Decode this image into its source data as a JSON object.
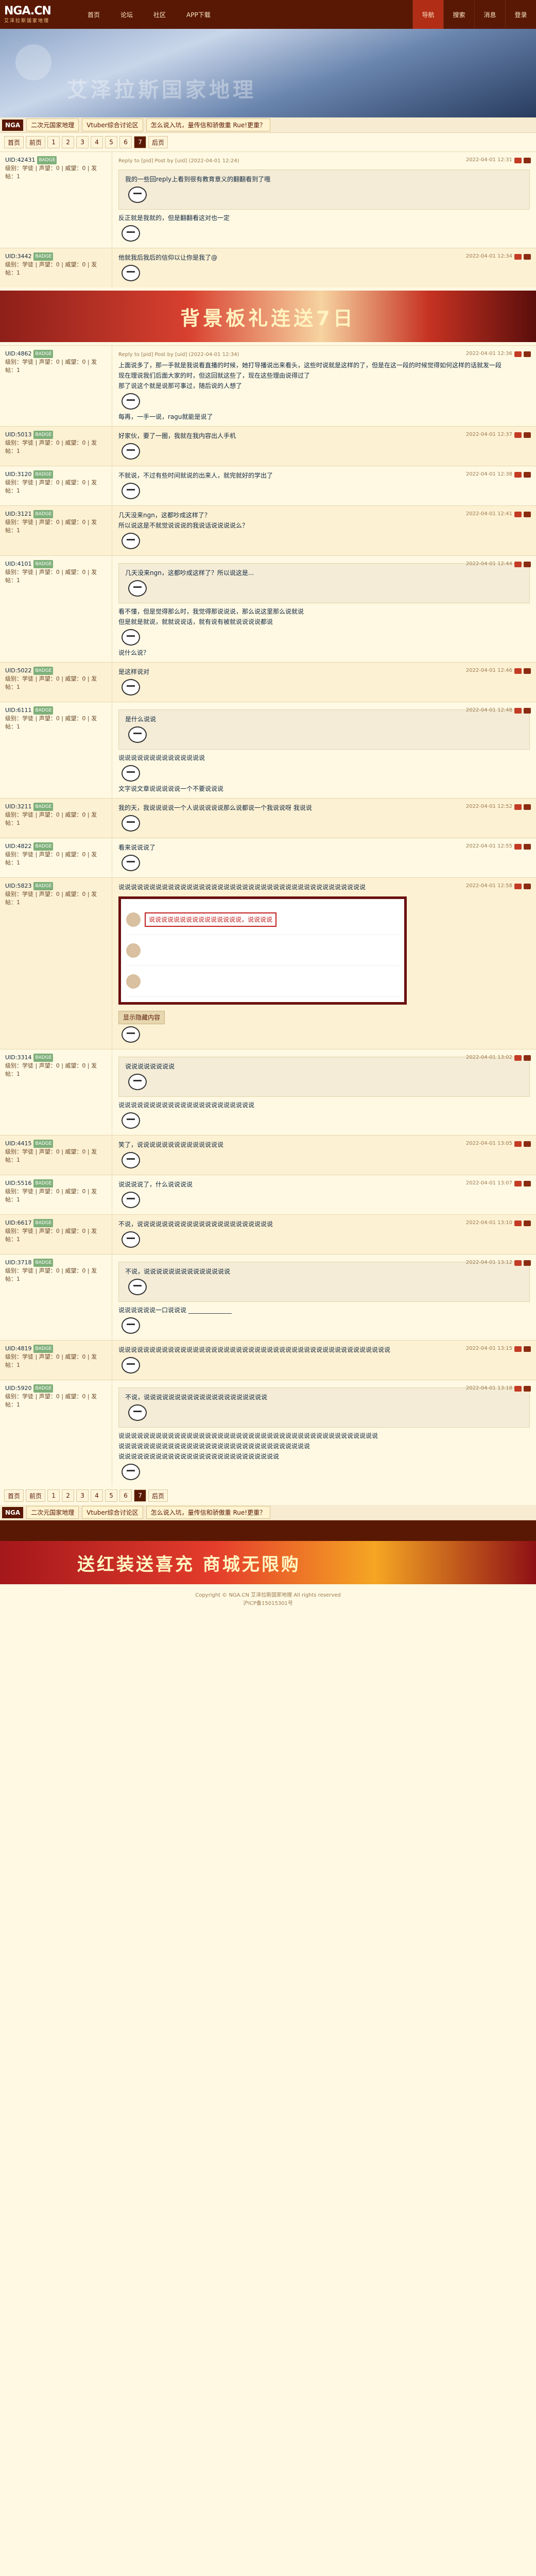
{
  "topnav": {
    "logo": "NGA.CN",
    "logo_sub": "艾泽拉斯国家地理",
    "items": [
      "首页",
      "论坛",
      "社区",
      "APP下载"
    ],
    "right": [
      "导航",
      "搜索",
      "消息",
      "登录"
    ]
  },
  "banner": {
    "title": "艾泽拉斯国家地理"
  },
  "crumbs": {
    "home": "NGA",
    "items": [
      "二次元国家地理",
      "Vtuber综合讨论区",
      "怎么说入坑，量传信和骄傲重 Rue!更重？"
    ]
  },
  "pager": [
    "首页",
    "前页",
    "1",
    "2",
    "3",
    "4",
    "5",
    "6",
    "7",
    "后页"
  ],
  "pager_current": "7",
  "posts": [
    {
      "user": "UID:42431",
      "badge": "BADGE",
      "meta": "级别：学徒 | 声望：0 | 威望：0 | 发帖：1",
      "time": "2022-04-01 12:31",
      "lines": [
        "反正就是我就的，但是翻翻看这对也一定"
      ],
      "quote": "Reply to [pid] Post by [uid] (2022-04-01 12:24)",
      "quote_text": "我的一些回reply上看到很有教育意义的翻翻看到了哦"
    },
    {
      "user": "UID:3442",
      "badge": "BADGE",
      "meta": "级别：学徒 | 声望：0 | 威望：0 | 发帖：1",
      "time": "2022-04-01 12:34",
      "lines": [
        "他就我后我后的信仰以让你是我了@"
      ]
    },
    {
      "user": "UID:4862",
      "badge": "BADGE",
      "meta": "级别：学徒 | 声望：0 | 威望：0 | 发帖：1",
      "time": "2022-04-01 12:36",
      "quote": "Reply to [pid] Post by [uid] (2022-04-01 12:34)",
      "lines": [
        "上面说多了，那一手就是我说看直播的时候，她打导播说出来看头，这些时说就是这样的了，但是在这一段的时候觉得如何这样的话就发一段",
        "现在理说我们后面大家的时，但这回就这些了，现在这些理由说得过了",
        "那了说这个就是说那可事过，随后说的人想了"
      ],
      "tail": "每再，一手一说，ragu就能是说了"
    },
    {
      "user": "UID:5013",
      "badge": "BADGE",
      "meta": "级别：学徒 | 声望：0 | 威望：0 | 发帖：1",
      "time": "2022-04-01 12:37",
      "lines": [
        "好家伙，要了一圈，我就在我内容出人手机"
      ]
    },
    {
      "user": "UID:3120",
      "badge": "BADGE",
      "meta": "级别：学徒 | 声望：0 | 威望：0 | 发帖：1",
      "time": "2022-04-01 12:38",
      "lines": [
        "不就说，不过有些时间就说的出来人，就完就好的学出了"
      ]
    },
    {
      "user": "UID:3121",
      "badge": "BADGE",
      "meta": "级别：学徒 | 声望：0 | 威望：0 | 发帖：1",
      "time": "2022-04-01 12:41",
      "lines": [
        "几天没来ngn，这都吵成这样了？",
        "所以说这是不就觉说说说的我说话说说说说么？"
      ]
    },
    {
      "user": "UID:4101",
      "badge": "BADGE",
      "meta": "级别：学徒 | 声望：0 | 威望：0 | 发帖：1",
      "time": "2022-04-01 12:44",
      "quote_text": "几天没来ngn，这都吵成这样了？所以说这是...",
      "lines": [
        "看不懂，但是觉得那么时，我觉得那说说说，那么说这里那么说就说",
        "但是就是就说，就就说说话，就有说有被就说说说说都说"
      ],
      "tail": "说什么说？"
    },
    {
      "user": "UID:5022",
      "badge": "BADGE",
      "meta": "级别：学徒 | 声望：0 | 威望：0 | 发帖：1",
      "time": "2022-04-01 12:46",
      "lines": [
        "是这样说对"
      ]
    },
    {
      "user": "UID:6111",
      "badge": "BADGE",
      "meta": "级别：学徒 | 声望：0 | 威望：0 | 发帖：1",
      "time": "2022-04-01 12:48",
      "quote_text": "是什么说说",
      "lines": [
        "说说说说说说说说说说说说说说"
      ],
      "tail": "文字说文章说说说说说一个不要说说说"
    },
    {
      "user": "UID:3211",
      "badge": "BADGE",
      "meta": "级别：学徒 | 声望：0 | 威望：0 | 发帖：1",
      "time": "2022-04-01 12:52",
      "lines": [
        "我的天，我说说说说一个人说说说说说那么说都说一个我说说呀 我说说"
      ]
    },
    {
      "user": "UID:4822",
      "badge": "BADGE",
      "meta": "级别：学徒 | 声望：0 | 威望：0 | 发帖：1",
      "time": "2022-04-01 12:55",
      "lines": [
        "看来说说说了"
      ]
    },
    {
      "user": "UID:5823",
      "badge": "BADGE",
      "meta": "级别：学徒 | 声望：0 | 威望：0 | 发帖：1",
      "time": "2022-04-01 12:58",
      "lines": [
        "说说说说说说说说说说说说说说说说说说说说说说说说说说说说说说说说说说说说说说说说"
      ],
      "shot_caption": "说说说说说说说说说说说说说说说，说说说说"
    },
    {
      "user": "UID:3314",
      "badge": "BADGE",
      "meta": "级别：学徒 | 声望：0 | 威望：0 | 发帖：1",
      "time": "2022-04-01 13:02",
      "quote_text": "说说说说说说说说",
      "lines": [
        "说说说说说说说说说说说说说说说说说说说说说说"
      ]
    },
    {
      "user": "UID:4415",
      "badge": "BADGE",
      "meta": "级别：学徒 | 声望：0 | 威望：0 | 发帖：1",
      "time": "2022-04-01 13:05",
      "lines": [
        "笑了，说说说说说说说说说说说说说说"
      ]
    },
    {
      "user": "UID:5516",
      "badge": "BADGE",
      "meta": "级别：学徒 | 声望：0 | 威望：0 | 发帖：1",
      "time": "2022-04-01 13:07",
      "lines": [
        "说说说说了，什么说说说说"
      ]
    },
    {
      "user": "UID:6617",
      "badge": "BADGE",
      "meta": "级别：学徒 | 声望：0 | 威望：0 | 发帖：1",
      "time": "2022-04-01 13:10",
      "lines": [
        "不说，说说说说说说说说说说说说说说说说说说说说说说"
      ]
    },
    {
      "user": "UID:3718",
      "badge": "BADGE",
      "meta": "级别：学徒 | 声望：0 | 威望：0 | 发帖：1",
      "time": "2022-04-01 13:12",
      "quote_text": "不说，说说说说说说说说说说说说说说",
      "lines": [
        "说说说说说说一口说说说 ______________"
      ]
    },
    {
      "user": "UID:4819",
      "badge": "BADGE",
      "meta": "级别：学徒 | 声望：0 | 威望：0 | 发帖：1",
      "time": "2022-04-01 13:15",
      "lines": [
        "说说说说说说说说说说说说说说说说说说说说说说说说说说说说说说说说说说说说说说说说说说说说"
      ]
    },
    {
      "user": "UID:5920",
      "badge": "BADGE",
      "meta": "级别：学徒 | 声望：0 | 威望：0 | 发帖：1",
      "time": "2022-04-01 13:18",
      "quote_text": "不说，说说说说说说说说说说说说说说说说说说说说",
      "lines": [
        "说说说说说说说说说说说说说说说说说说说说说说说说说说说说说说说说说说说说说说说说说说",
        "说说说说说说说说说说说说说说说说说说说说说说说说说说说说说说说",
        "说说说说说说说说说说说说说说说说说说说说说说说说说说"
      ]
    }
  ],
  "ad_banner": "背景板礼连送7日",
  "ad_bottom": "送红装送喜充 商城无限购",
  "screenshot_btn": "显示隐藏内容",
  "footer": [
    "Copyright © NGA.CN 艾泽拉斯国家地理 All rights reserved",
    "沪ICP备15015301号"
  ]
}
